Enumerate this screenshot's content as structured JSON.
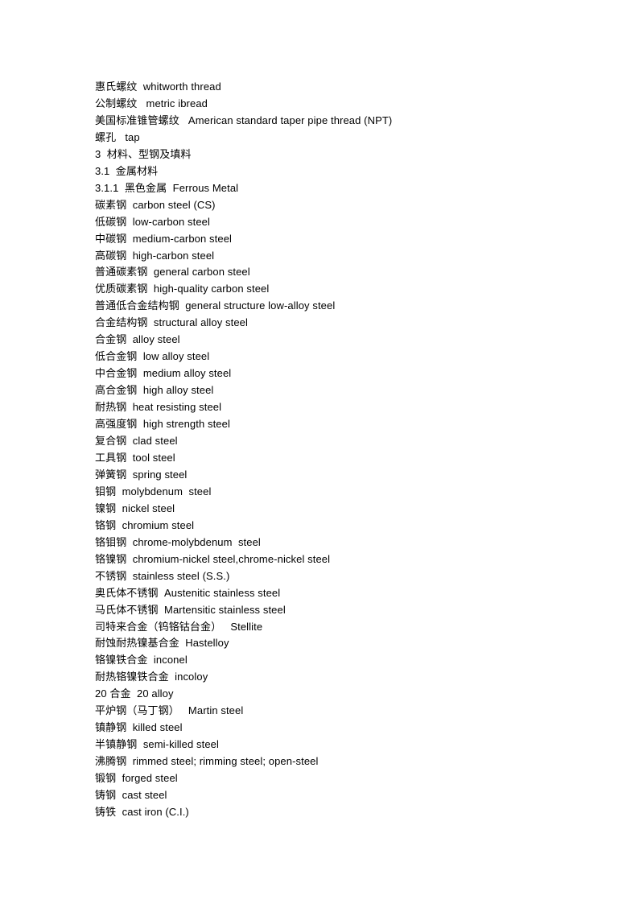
{
  "document": {
    "background_color": "#ffffff",
    "text_color": "#000000",
    "lines": [
      {
        "id": "line-1",
        "text": "惠氏螺纹  whitworth thread"
      },
      {
        "id": "line-2",
        "text": "公制螺纹   metric ibread"
      },
      {
        "id": "line-3",
        "text": "美国标准锥管螺纹   American standard taper pipe thread (NPT)"
      },
      {
        "id": "line-4",
        "text": "螺孔   tap"
      },
      {
        "id": "line-5",
        "text": "3  材料、型钢及填料"
      },
      {
        "id": "line-6",
        "text": "3.1  金属材料"
      },
      {
        "id": "line-7",
        "text": "3.1.1  黑色金属  Ferrous Metal"
      },
      {
        "id": "line-8",
        "text": "碳素钢  carbon steel (CS)"
      },
      {
        "id": "line-9",
        "text": "低碳钢  low-carbon steel"
      },
      {
        "id": "line-10",
        "text": "中碳钢  medium-carbon steel"
      },
      {
        "id": "line-11",
        "text": "高碳钢  high-carbon steel"
      },
      {
        "id": "line-12",
        "text": "普通碳素钢  general carbon steel"
      },
      {
        "id": "line-13",
        "text": "优质碳素钢  high-quality carbon steel"
      },
      {
        "id": "line-14",
        "text": "普通低合金结构钢  general structure low-alloy steel"
      },
      {
        "id": "line-15",
        "text": "合金结构钢  structural alloy steel"
      },
      {
        "id": "line-16",
        "text": "合金钢  alloy steel"
      },
      {
        "id": "line-17",
        "text": "低合金钢  low alloy steel"
      },
      {
        "id": "line-18",
        "text": "中合金钢  medium alloy steel"
      },
      {
        "id": "line-19",
        "text": "高合金钢  high alloy steel"
      },
      {
        "id": "line-20",
        "text": "耐热钢  heat resisting steel"
      },
      {
        "id": "line-21",
        "text": "高强度钢  high strength steel"
      },
      {
        "id": "line-22",
        "text": "复合钢  clad steel"
      },
      {
        "id": "line-23",
        "text": "工具钢  tool steel"
      },
      {
        "id": "line-24",
        "text": "弹簧钢  spring steel"
      },
      {
        "id": "line-25",
        "text": "钼钢  molybdenum  steel"
      },
      {
        "id": "line-26",
        "text": "镍钢  nickel steel"
      },
      {
        "id": "line-27",
        "text": "铬钢  chromium steel"
      },
      {
        "id": "line-28",
        "text": "铬钼钢  chrome-molybdenum  steel"
      },
      {
        "id": "line-29",
        "text": "铬镍钢  chromium-nickel steel,chrome-nickel steel"
      },
      {
        "id": "line-30",
        "text": "不锈钢  stainless steel (S.S.)"
      },
      {
        "id": "line-31",
        "text": "奥氏体不锈钢  Austenitic stainless steel"
      },
      {
        "id": "line-32",
        "text": "马氏体不锈钢  Martensitic stainless steel"
      },
      {
        "id": "line-33",
        "text": "司特来合金（钨铬钴台金）   Stellite"
      },
      {
        "id": "line-34",
        "text": "耐蚀耐热镍基合金  Hastelloy"
      },
      {
        "id": "line-35",
        "text": "铬镍铁合金  inconel"
      },
      {
        "id": "line-36",
        "text": "耐热铬镍铁合金  incoloy"
      },
      {
        "id": "line-37",
        "text": "20 合金  20 alloy"
      },
      {
        "id": "line-38",
        "text": "平炉钢（马丁钢）   Martin steel"
      },
      {
        "id": "line-39",
        "text": "镇静钢  killed steel"
      },
      {
        "id": "line-40",
        "text": "半镇静钢  semi-killed steel"
      },
      {
        "id": "line-41",
        "text": "沸腾钢  rimmed steel; rimming steel; open-steel"
      },
      {
        "id": "line-42",
        "text": "锻钢  forged steel"
      },
      {
        "id": "line-43",
        "text": "铸钢  cast steel"
      },
      {
        "id": "line-44",
        "text": "铸铁  cast iron (C.I.)"
      }
    ]
  }
}
